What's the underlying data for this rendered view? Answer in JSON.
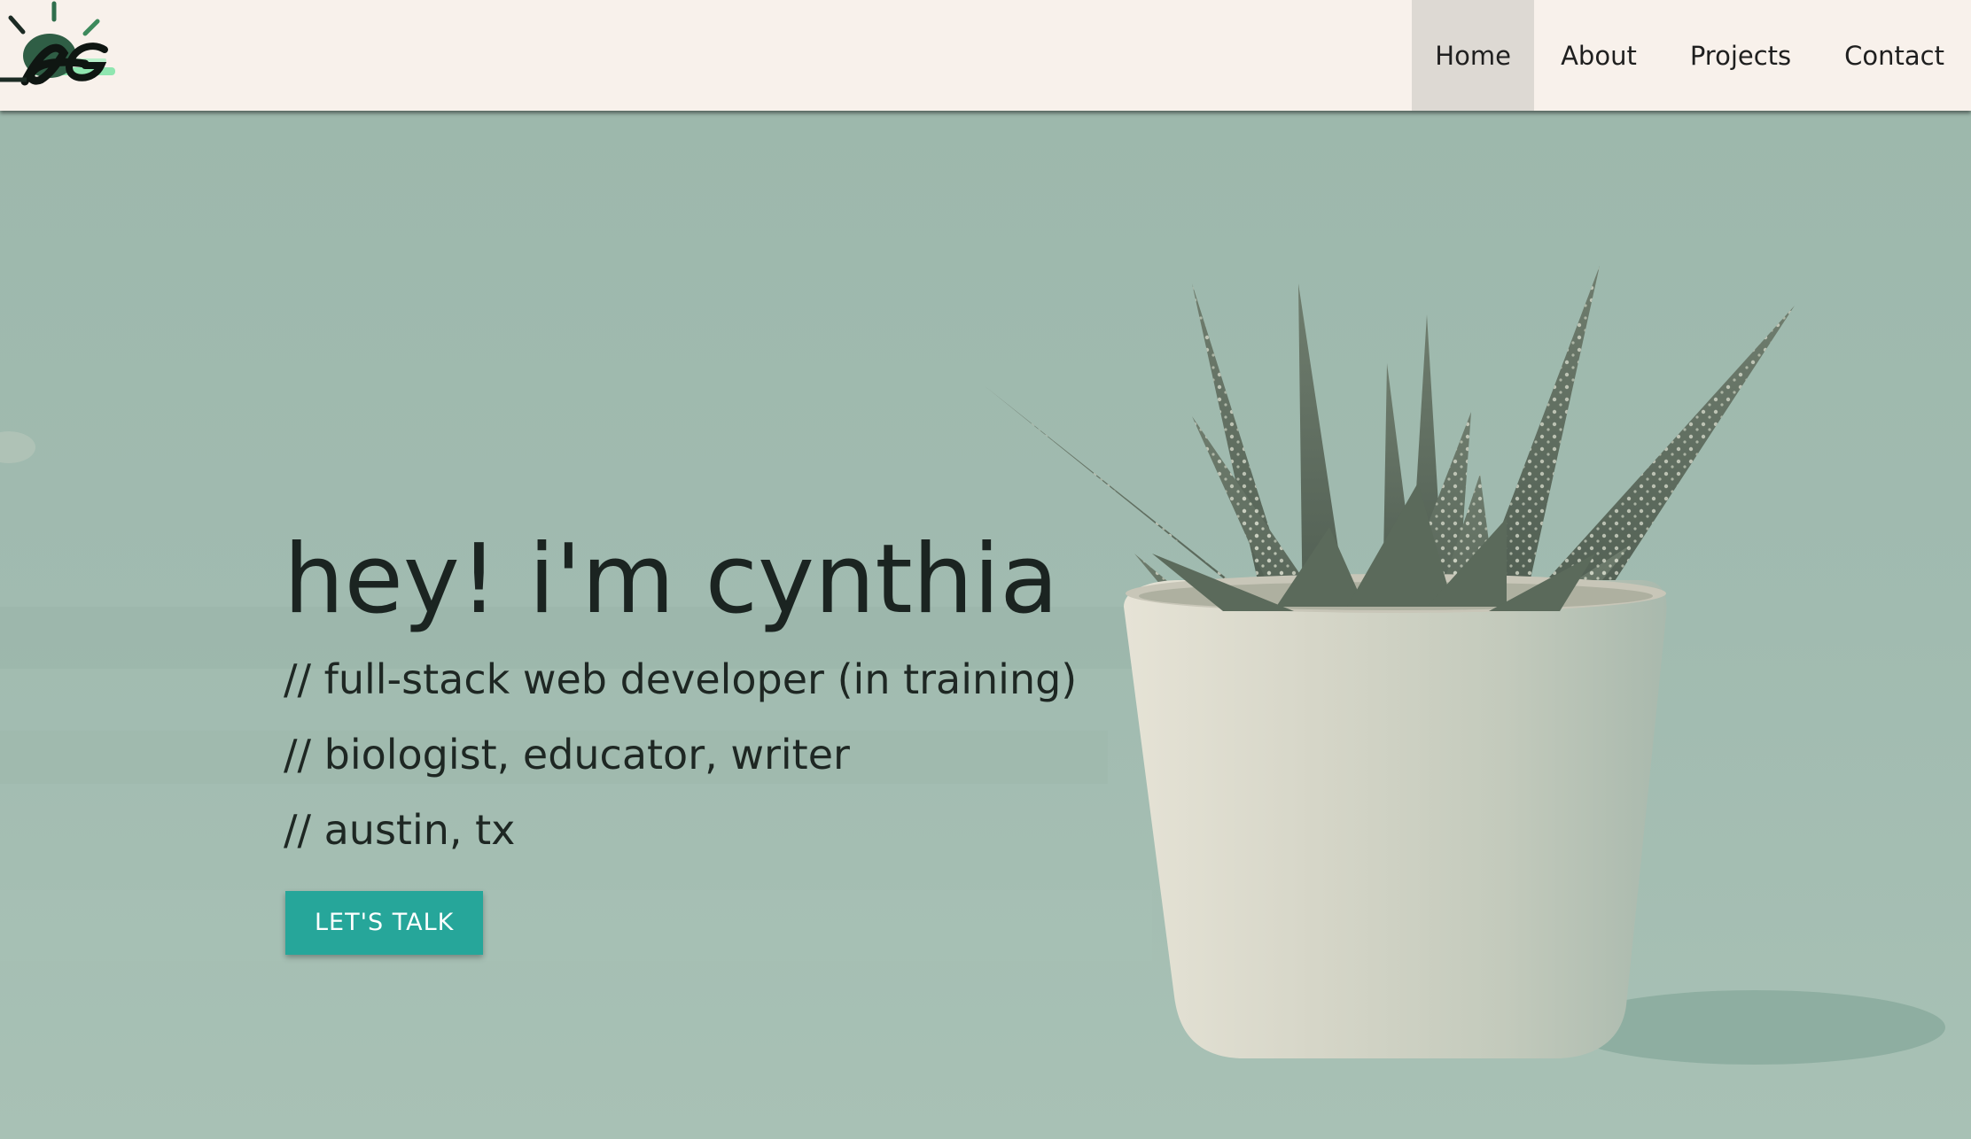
{
  "nav": {
    "links": [
      {
        "label": "Home",
        "active": true
      },
      {
        "label": "About"
      },
      {
        "label": "Projects"
      },
      {
        "label": "Contact"
      }
    ]
  },
  "hero": {
    "title": "hey! i'm cynthia",
    "lines": [
      "// full-stack web developer (in training)",
      "// biologist, educator, writer",
      "// austin, tx"
    ],
    "cta_label": "LET'S TALK"
  },
  "colors": {
    "nav_bg": "#f8f1eb",
    "active_tab_bg": "#ddd9d3",
    "hero_bg": "#a3bdb2",
    "accent": "#26a69a",
    "text": "#1b2421"
  },
  "icons": {
    "logo": "initials-logo-with-sunrays",
    "hero_image": "succulent-in-white-pot"
  }
}
